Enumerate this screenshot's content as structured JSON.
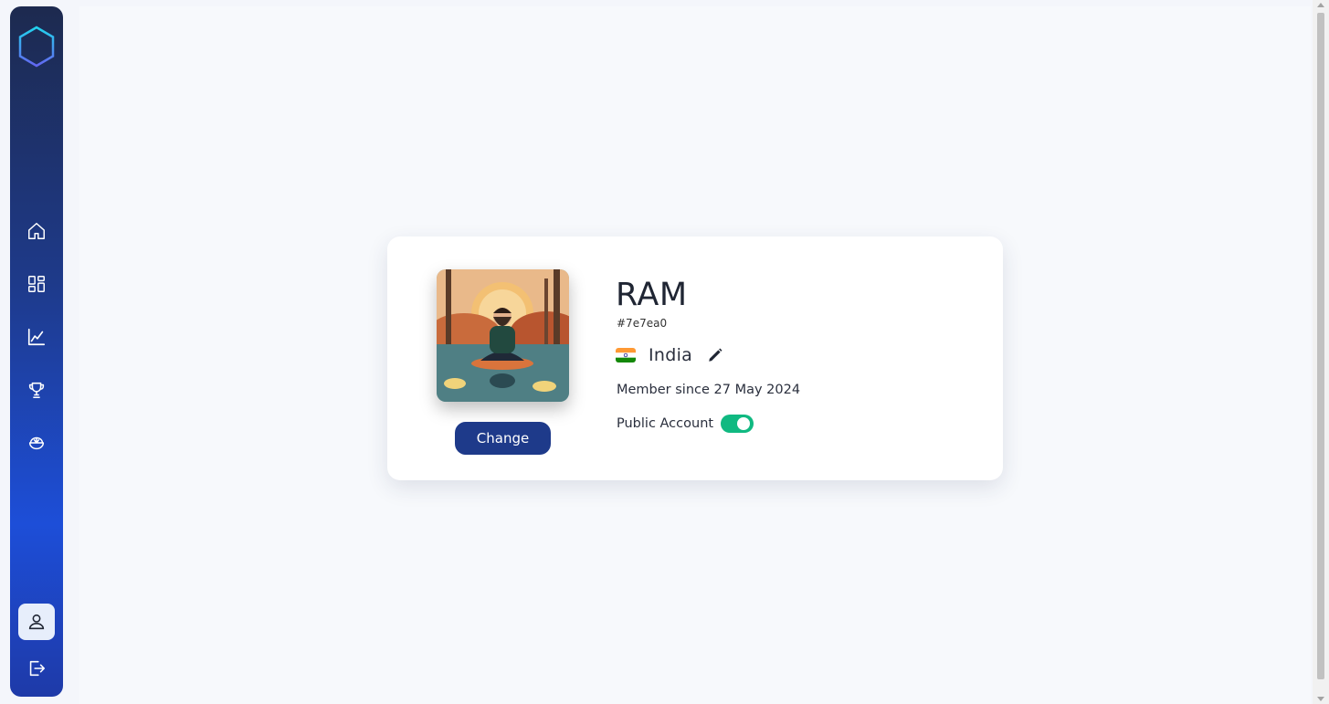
{
  "sidebar": {
    "logo_icon": "hexagon-logo",
    "items": [
      {
        "name": "home",
        "icon": "home-icon"
      },
      {
        "name": "dashboard",
        "icon": "grid-icon"
      },
      {
        "name": "stats",
        "icon": "chart-line-icon"
      },
      {
        "name": "achievements",
        "icon": "trophy-icon"
      },
      {
        "name": "meals",
        "icon": "bowl-icon"
      }
    ],
    "profile": {
      "icon": "user-icon",
      "active": true
    },
    "logout": {
      "icon": "logout-icon"
    }
  },
  "profile": {
    "username": "RAM",
    "user_id": "#7e7ea0",
    "country": "India",
    "flag_icon": "india-flag-icon",
    "member_since": "Member since 27 May 2024",
    "public_account_label": "Public Account",
    "public_account_enabled": true,
    "change_button_label": "Change"
  },
  "colors": {
    "sidebar_top": "#1d2a4f",
    "sidebar_bottom": "#1d4ed8",
    "button": "#1e3a8a",
    "toggle_on": "#10b981",
    "background": "#f7f9fc"
  }
}
